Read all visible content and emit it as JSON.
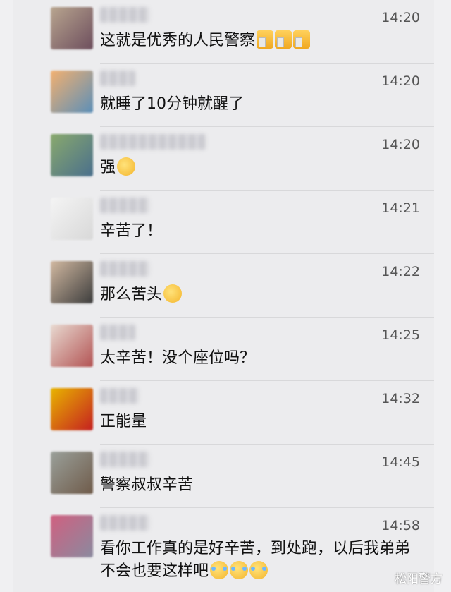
{
  "messages": [
    {
      "time": "14:20",
      "text": "这就是优秀的人民警察",
      "emoji": [
        "thumbs-up-icon",
        "thumbs-up-icon",
        "thumbs-up-icon"
      ]
    },
    {
      "time": "14:20",
      "text": "就睡了10分钟就醒了",
      "emoji": []
    },
    {
      "time": "14:20",
      "text": "强",
      "emoji": [
        "thinking-face-icon"
      ]
    },
    {
      "time": "14:21",
      "text": "辛苦了！",
      "emoji": []
    },
    {
      "time": "14:22",
      "text": "那么苦头",
      "emoji": [
        "pleading-face-icon"
      ]
    },
    {
      "time": "14:25",
      "text": "太辛苦！没个座位吗？",
      "emoji": []
    },
    {
      "time": "14:32",
      "text": "正能量",
      "emoji": []
    },
    {
      "time": "14:45",
      "text": "警察叔叔辛苦",
      "emoji": []
    },
    {
      "time": "14:58",
      "text": "看你工作真的是好辛苦，到处跑，以后我弟弟不会也要这样吧",
      "emoji": [
        "laughing-tears-icon",
        "laughing-tears-icon",
        "laughing-tears-icon"
      ]
    }
  ],
  "watermark": "松阳警方"
}
